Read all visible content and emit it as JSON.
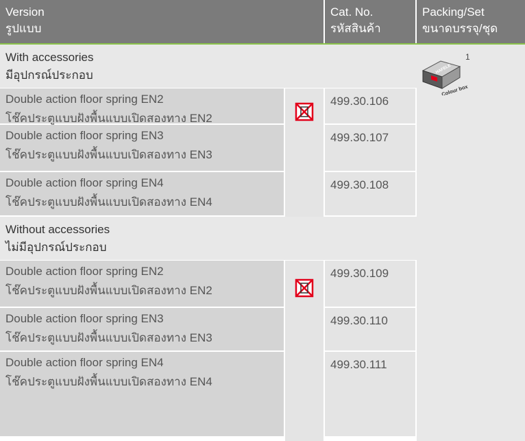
{
  "header": {
    "version_en": "Version",
    "version_th": "รูปแบบ",
    "cat_en": "Cat. No.",
    "cat_th": "รหัสสินค้า",
    "pack_en": "Packing/Set",
    "pack_th": "ขนาดบรรจุ/ชุด"
  },
  "colors": {
    "header_bg": "#7b7b7b",
    "accent_green": "#8bc34a",
    "mark_red": "#e2001a"
  },
  "groups": [
    {
      "title_en": "With accessories",
      "title_th": "มีอุปกรณ์ประกอบ",
      "rows": [
        {
          "en": "Double action floor spring EN2",
          "th": "โช๊คประตูแบบฝังพื้นแบบเปิดสองทาง  EN2",
          "cat": "499.30.106"
        },
        {
          "en": "Double action floor spring EN3",
          "th": "โช๊คประตูแบบฝังพื้นแบบเปิดสองทาง  EN3",
          "cat": "499.30.107"
        },
        {
          "en": "Double action floor spring EN4",
          "th": "โช๊คประตูแบบฝังพื้นแบบเปิดสองทาง  EN4",
          "cat": "499.30.108"
        }
      ]
    },
    {
      "title_en": "Without accessories",
      "title_th": "ไม่มีอุปกรณ์ประกอบ",
      "rows": [
        {
          "en": "Double action floor spring EN2",
          "th": "โช๊คประตูแบบฝังพื้นแบบเปิดสองทาง  EN2",
          "cat": "499.30.109"
        },
        {
          "en": "Double action floor spring EN3",
          "th": "โช๊คประตูแบบฝังพื้นแบบเปิดสองทาง  EN3",
          "cat": "499.30.110"
        },
        {
          "en": "Double action floor spring EN4",
          "th": "โช๊คประตูแบบฝังพื้นแบบเปิดสองทาง  EN4",
          "cat": "499.30.111"
        }
      ]
    }
  ],
  "packing": {
    "quantity": "1",
    "box_brand": "HAFELE",
    "box_caption": "Colour box",
    "icon": "colour-box-icon"
  },
  "mark_icon": "crossed-box-mark-icon"
}
